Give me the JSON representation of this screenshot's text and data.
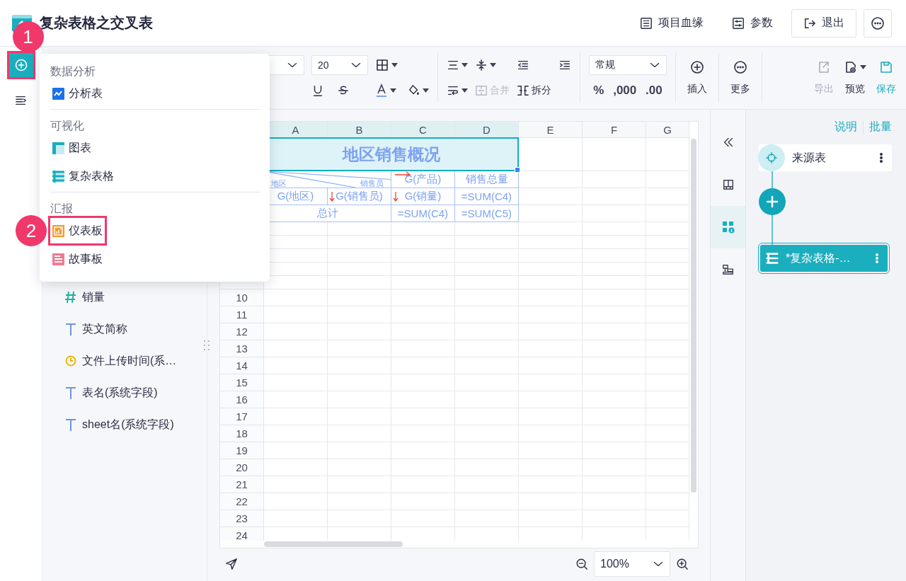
{
  "header": {
    "title": "复杂表格之交叉表",
    "links": [
      {
        "label": "项目血缘",
        "kind": "lineage"
      },
      {
        "label": "参数",
        "kind": "params"
      }
    ],
    "exit_button": "退出"
  },
  "rail": [
    {
      "kind": "add",
      "selected": true,
      "callout": "1"
    },
    {
      "kind": "outline",
      "selected": false
    }
  ],
  "menu": {
    "sections": [
      {
        "title": "数据分析",
        "items": [
          {
            "label": "分析表",
            "kind": "analysis",
            "highlighted": false
          }
        ]
      },
      {
        "title": "可视化",
        "items": [
          {
            "label": "图表",
            "kind": "chart",
            "highlighted": false
          },
          {
            "label": "复杂表格",
            "kind": "table",
            "highlighted": false
          }
        ]
      },
      {
        "title": "汇报",
        "items": [
          {
            "label": "仪表板",
            "kind": "dashboard",
            "highlighted": true,
            "callout": "2"
          },
          {
            "label": "故事板",
            "kind": "story",
            "highlighted": false
          }
        ]
      }
    ]
  },
  "toolbar": {
    "font_size": "20",
    "merge": {
      "label": "合并",
      "disabled": true
    },
    "split": {
      "label": "拆分",
      "disabled": false
    },
    "number_format": "常规",
    "formats": [
      "%",
      ",000",
      ".00"
    ],
    "insert": "插入",
    "more": "更多",
    "actions": [
      {
        "label": "导出",
        "kind": "export",
        "disabled": true
      },
      {
        "label": "预览",
        "kind": "preview",
        "disabled": false
      },
      {
        "label": "保存",
        "kind": "save",
        "disabled": false
      }
    ]
  },
  "fields": [
    {
      "label": "销量",
      "kind": "number"
    },
    {
      "label": "英文简称",
      "kind": "text"
    },
    {
      "label": "文件上传时间(系…",
      "kind": "date"
    },
    {
      "label": "表名(系统字段)",
      "kind": "text"
    },
    {
      "label": "sheet名(系统字段)",
      "kind": "text"
    }
  ],
  "sheet": {
    "columns": [
      {
        "label": "A",
        "selected": true
      },
      {
        "label": "B",
        "selected": true
      },
      {
        "label": "C",
        "selected": true
      },
      {
        "label": "D",
        "selected": true
      },
      {
        "label": "E",
        "selected": false
      },
      {
        "label": "F",
        "selected": false
      },
      {
        "label": "G",
        "selected": false
      }
    ],
    "row_numbers": [
      "10",
      "11",
      "12",
      "13",
      "14",
      "15",
      "16",
      "17",
      "18",
      "19",
      "20",
      "21",
      "22",
      "23",
      "24"
    ],
    "rows": [
      {
        "cells": [
          {
            "kind": "title",
            "text": "地区销售概况",
            "selected": true
          }
        ]
      },
      {
        "cells": [
          {
            "kind": "diagonal",
            "labels": [
              "地区",
              "销售员"
            ]
          },
          {
            "kind": "field",
            "text": "G(产品)",
            "expands_across": true,
            "expands_down": false
          },
          {
            "kind": "field",
            "text": "销售总量",
            "expands_across": false,
            "expands_down": false
          }
        ]
      },
      {
        "cells": [
          {
            "kind": "field",
            "text": "G(地区)",
            "expands_across": false,
            "expands_down": false
          },
          {
            "kind": "field",
            "text": "G(销售员)",
            "expands_across": false,
            "expands_down": true
          },
          {
            "kind": "field",
            "text": "G(销量)",
            "expands_across": false,
            "expands_down": true
          },
          {
            "kind": "field",
            "text": "=SUM(C4)",
            "expands_across": false,
            "expands_down": false
          }
        ]
      },
      {
        "cells": [
          {
            "kind": "total",
            "text": "总计"
          },
          {
            "kind": "field",
            "text": "=SUM(C4)",
            "expands_across": false,
            "expands_down": false
          },
          {
            "kind": "field",
            "text": "=SUM(C5)",
            "expands_across": false,
            "expands_down": false
          }
        ]
      }
    ]
  },
  "zoom": "100%",
  "side_tabs": [
    {
      "kind": "collapse",
      "selected": false
    },
    {
      "kind": "layout",
      "selected": false
    },
    {
      "kind": "widgets",
      "selected": true
    },
    {
      "kind": "structure",
      "selected": false
    }
  ],
  "flow_panel": {
    "links": [
      "说明",
      "批量"
    ],
    "nodes": [
      {
        "label": "来源表",
        "kind": "source",
        "selected": false
      },
      {
        "label": "*复杂表格-…",
        "kind": "table",
        "selected": true
      }
    ]
  }
}
